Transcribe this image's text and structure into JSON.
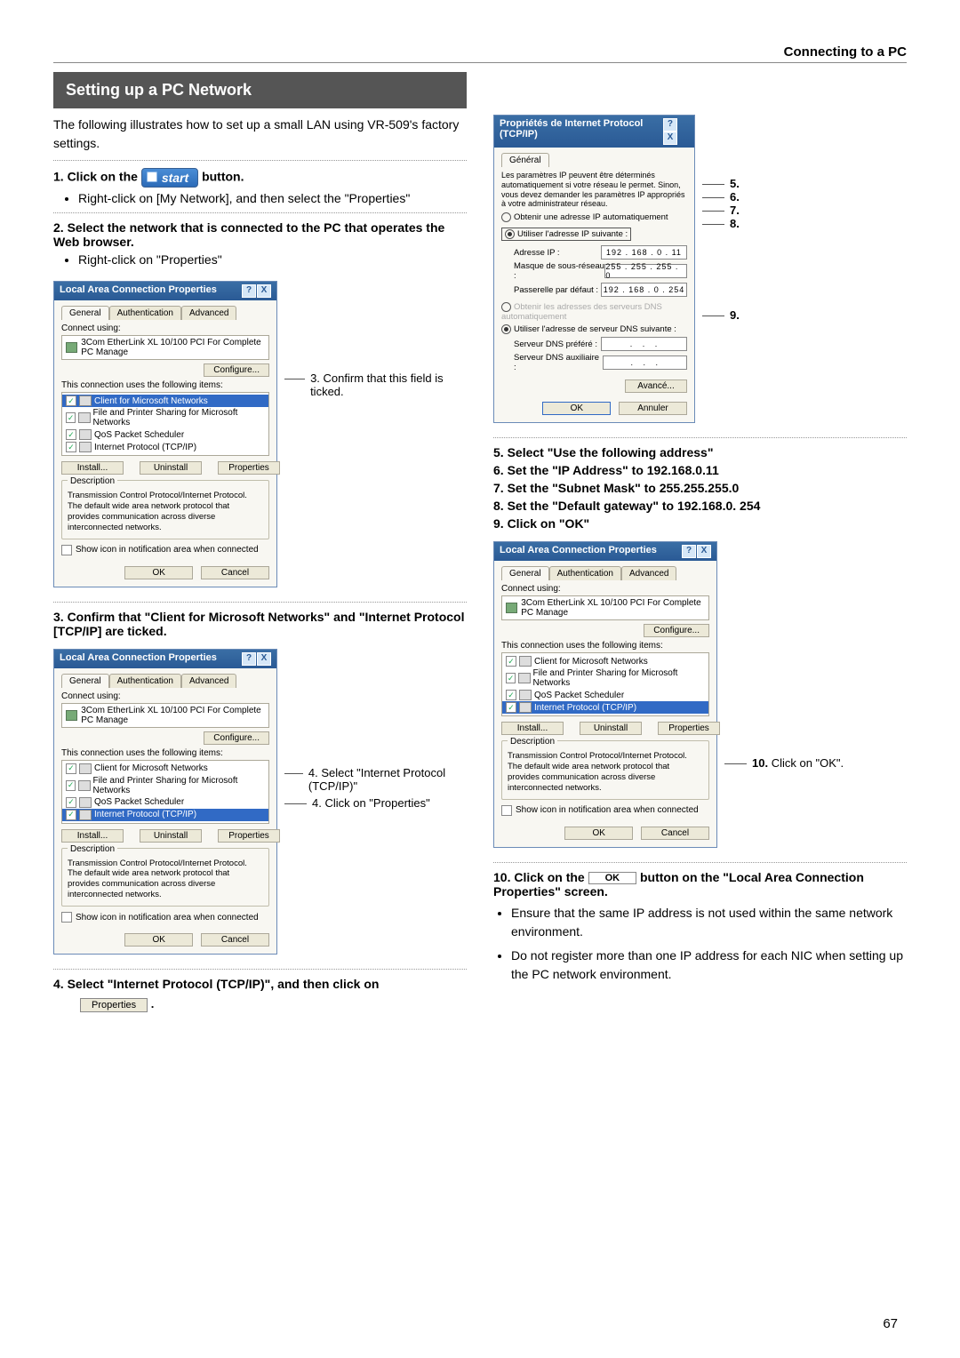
{
  "header": "Connecting to a PC",
  "section_title": "Setting up a PC Network",
  "intro": "The following illustrates how to set up a small LAN using VR-509's factory settings.",
  "step1_a": "1.  Click on the",
  "start_label": "start",
  "step1_b": "button.",
  "step1_sub": "Right-click on [My Network], and then select the \"Properties\"",
  "step2": "2.  Select the network that is connected to the PC that operates the Web browser.",
  "step2_sub": "Right-click on \"Properties\"",
  "note3": "3. Confirm that this field is ticked.",
  "step3": "3.  Confirm that \"Client for Microsoft Networks\" and \"Internet Protocol [TCP/IP] are ticked.",
  "note4a": "4. Select \"Internet Protocol (TCP/IP)\"",
  "note4b": "4. Click on \"Properties\"",
  "step4": "4.  Select \"Internet Protocol (TCP/IP)\", and then click on",
  "prop_btn": "Properties",
  "step5": "5.  Select \"Use the following address\"",
  "step6": "6.  Set the \"IP Address\" to 192.168.0.11",
  "step7": "7.  Set the \"Subnet Mask\" to 255.255.255.0",
  "step8": "8.  Set the \"Default gateway\" to 192.168.0. 254",
  "step9": "9.  Click on \"OK\"",
  "note10": "10. Click on \"OK\".",
  "step10a": "10. Click on the",
  "ok_btn": "OK",
  "step10b": "button on the \"Local Area Connection Properties\" screen.",
  "tip1": "Ensure that the same IP address is not used within the same network environment.",
  "tip2": "Do not register more than one IP address for each NIC when setting up the PC network environment.",
  "page_num": "67",
  "lac": {
    "title": "Local Area Connection Properties",
    "tab_general": "General",
    "tab_auth": "Authentication",
    "tab_adv": "Advanced",
    "connect_using": "Connect using:",
    "nic": "3Com EtherLink XL 10/100 PCI For Complete PC Manage",
    "configure": "Configure...",
    "uses_items": "This connection uses the following items:",
    "item_client": "Client for Microsoft Networks",
    "item_fps": "File and Printer Sharing for Microsoft Networks",
    "item_qos": "QoS Packet Scheduler",
    "item_tcpip": "Internet Protocol (TCP/IP)",
    "install": "Install...",
    "uninstall": "Uninstall",
    "properties": "Properties",
    "desc_title": "Description",
    "desc_text": "Transmission Control Protocol/Internet Protocol. The default wide area network protocol that provides communication across diverse interconnected networks.",
    "show_icon": "Show icon in notification area when connected",
    "ok": "OK",
    "cancel": "Cancel"
  },
  "ip": {
    "title": "Propriétés de Internet Protocol (TCP/IP)",
    "tab": "Général",
    "info": "Les paramètres IP peuvent être déterminés automatiquement si votre réseau le permet. Sinon, vous devez demander les paramètres IP appropriés à votre administrateur réseau.",
    "auto": "Obtenir une adresse IP automatiquement",
    "manual": "Utiliser l'adresse IP suivante :",
    "addr_lbl": "Adresse IP :",
    "addr_val": "192 . 168 .  0  .  11",
    "mask_lbl": "Masque de sous-réseau :",
    "mask_val": "255 . 255 . 255 .  0",
    "gw_lbl": "Passerelle par défaut :",
    "gw_val": "192 . 168 .  0  . 254",
    "dns_auto": "Obtenir les adresses des serveurs DNS automatiquement",
    "dns_manual": "Utiliser l'adresse de serveur DNS suivante :",
    "dns1": "Serveur DNS préféré :",
    "dns2": "Serveur DNS auxiliaire :",
    "advanced": "Avancé...",
    "ok": "OK",
    "cancel": "Annuler"
  },
  "callout5": "5.",
  "callout6": "6.",
  "callout7": "7.",
  "callout8": "8.",
  "callout9": "9."
}
